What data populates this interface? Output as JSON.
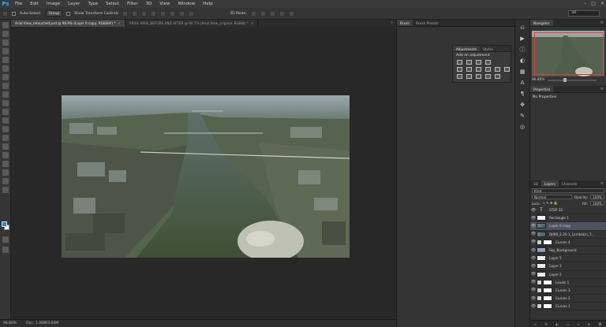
{
  "app": {
    "logo": "Ps"
  },
  "menu": [
    "File",
    "Edit",
    "Image",
    "Layer",
    "Type",
    "Select",
    "Filter",
    "3D",
    "View",
    "Window",
    "Help"
  ],
  "window_controls": [
    "–",
    "□",
    "✕"
  ],
  "options": {
    "auto_select_label": "Auto-Select:",
    "auto_select_value": "Group",
    "show_transform": "Show Transform Controls",
    "mode_3d": "3D Mode:",
    "workspace": "3D"
  },
  "tabs": [
    {
      "label": "Arial View_retouched.psd @ 96.9% (Layer 0 copy, RGB/8#) *",
      "active": true
    },
    {
      "label": "ARIAL VIEW_BEFORE AND AFTER @ 90.7% (Arial View_original, RGB/8) *",
      "active": false
    }
  ],
  "tabs_more": "»",
  "status": {
    "zoom": "96.86%",
    "doc": "Doc: 1.46M/3.00M"
  },
  "midpanel": {
    "tabs": [
      "Brush",
      "Brush Presets"
    ],
    "adjustments": {
      "tabs": [
        "Adjustments",
        "Styles"
      ],
      "title": "Add an adjustment"
    }
  },
  "navigator": {
    "tabs": [
      "Navigator"
    ],
    "zoom": "96.86%"
  },
  "properties": {
    "tabs": [
      "Properties"
    ],
    "empty": "No Properties"
  },
  "layers_panel": {
    "tabs": [
      "3D",
      "Layers",
      "Channels"
    ],
    "filter": "Kind",
    "blend": "Normal",
    "opacity_label": "Opacity:",
    "opacity": "100%",
    "lock_label": "Lock:",
    "fill_label": "Fill:",
    "fill": "100%",
    "layers": [
      {
        "name": "STEP 32",
        "kind": "text",
        "selected": false
      },
      {
        "name": "Rectangle 1",
        "kind": "shape",
        "selected": false
      },
      {
        "name": "Layer 0 copy",
        "kind": "img",
        "selected": true
      },
      {
        "name": "DJI09_2.35-1_Lambskin_T...",
        "kind": "img",
        "selected": false
      },
      {
        "name": "Curves 4",
        "kind": "adj",
        "selected": false
      },
      {
        "name": "Sky_Background",
        "kind": "sky",
        "selected": false
      },
      {
        "name": "Layer 5",
        "kind": "trans",
        "selected": false
      },
      {
        "name": "Layer 3",
        "kind": "trans",
        "selected": false
      },
      {
        "name": "Layer 2",
        "kind": "trans",
        "selected": false
      },
      {
        "name": "Levels 1",
        "kind": "adj",
        "selected": false
      },
      {
        "name": "Curves 3",
        "kind": "adj",
        "selected": false
      },
      {
        "name": "Curves 2",
        "kind": "adj",
        "selected": false
      },
      {
        "name": "Curves 1",
        "kind": "adj",
        "selected": false
      }
    ],
    "footer": [
      "fx",
      "◐",
      "▭",
      "▫",
      "⊞",
      "🗑"
    ]
  }
}
